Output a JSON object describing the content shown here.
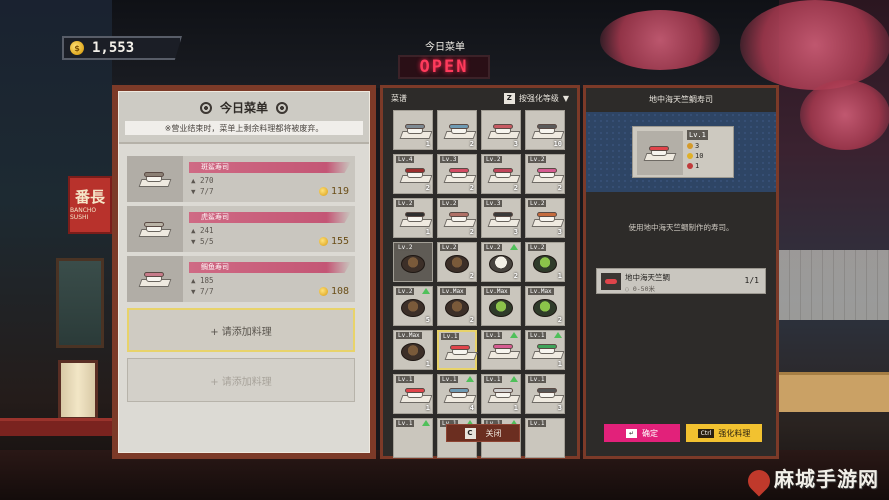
{
  "colors": {
    "accent_pink": "#e2217a",
    "accent_yellow": "#f2c230",
    "panel_frame": "#7c3a28",
    "open_red": "#ff3b5c"
  },
  "hud": {
    "currency_icon": "coin-icon",
    "currency": "1,553"
  },
  "header": {
    "today_menu": "今日菜单",
    "open_sign": "OPEN"
  },
  "left": {
    "title": "今日菜单",
    "note": "※营业结束时，菜单上剩余料理都将被废弃。",
    "dishes": [
      {
        "name": "斑鲨寿司",
        "stock": "270",
        "ratio": "7/7",
        "price": "119",
        "fish": "#8b7f74"
      },
      {
        "name": "虎鲨寿司",
        "stock": "241",
        "ratio": "5/5",
        "price": "155",
        "fish": "#b9b3a6"
      },
      {
        "name": "鲷鱼寿司",
        "stock": "185",
        "ratio": "7/7",
        "price": "108",
        "fish": "#c77b8a"
      }
    ],
    "add_slot_1": "+ 请添加料理",
    "add_slot_2": "+ 请添加料理"
  },
  "middle": {
    "tab_label": "菜谱",
    "sort_key": "Z",
    "sort_label": "按强化等级",
    "cells": [
      {
        "lv": "",
        "count": "1",
        "up": false,
        "food": "sushi",
        "color": "#7e8a93"
      },
      {
        "lv": "",
        "count": "2",
        "up": false,
        "food": "sushi",
        "color": "#6e9ab3"
      },
      {
        "lv": "",
        "count": "3",
        "up": false,
        "food": "sushi",
        "color": "#c75a62"
      },
      {
        "lv": "",
        "count": "10",
        "up": false,
        "food": "sushi",
        "color": "#5a5a5a"
      },
      {
        "lv": "Lv.4",
        "count": "2",
        "up": false,
        "food": "sushi",
        "color": "#9b2d2d"
      },
      {
        "lv": "Lv.3",
        "count": "2",
        "up": false,
        "food": "sushi",
        "color": "#d34c64"
      },
      {
        "lv": "Lv.2",
        "count": "2",
        "up": false,
        "food": "sushi",
        "color": "#c0455b"
      },
      {
        "lv": "Lv.2",
        "count": "2",
        "up": false,
        "food": "sushi",
        "color": "#d65c92"
      },
      {
        "lv": "Lv.2",
        "count": "1",
        "up": false,
        "food": "sushi",
        "color": "#2f2f2f"
      },
      {
        "lv": "Lv.2",
        "count": "2",
        "up": false,
        "food": "sushi",
        "color": "#b07066"
      },
      {
        "lv": "Lv.3",
        "count": "3",
        "up": false,
        "food": "sushi",
        "color": "#3a3a3a"
      },
      {
        "lv": "Lv.2",
        "count": "3",
        "up": false,
        "food": "sushi",
        "color": "#c56b3d"
      },
      {
        "lv": "Lv.2",
        "count": "",
        "up": false,
        "food": "bowl",
        "color": "",
        "dark": true
      },
      {
        "lv": "Lv.2",
        "count": "2",
        "up": false,
        "food": "bowl",
        "color": ""
      },
      {
        "lv": "Lv.2",
        "count": "2",
        "up": true,
        "food": "bowl-white",
        "color": ""
      },
      {
        "lv": "Lv.2",
        "count": "1",
        "up": false,
        "food": "bowl-green",
        "color": ""
      },
      {
        "lv": "Lv.2",
        "count": "5",
        "up": true,
        "food": "bowl",
        "color": ""
      },
      {
        "lv": "Lv.Max",
        "count": "2",
        "up": false,
        "food": "bowl",
        "color": ""
      },
      {
        "lv": "Lv.Max",
        "count": "",
        "up": false,
        "food": "bowl-green",
        "color": ""
      },
      {
        "lv": "Lv.Max",
        "count": "2",
        "up": false,
        "food": "bowl-green",
        "color": ""
      },
      {
        "lv": "Lv.Max",
        "count": "1",
        "up": false,
        "food": "bowl",
        "color": ""
      },
      {
        "lv": "Lv.1",
        "count": "",
        "up": false,
        "food": "sushi",
        "color": "#e0444a",
        "hl": true
      },
      {
        "lv": "Lv.1",
        "count": "",
        "up": true,
        "food": "sushi",
        "color": "#d65c92"
      },
      {
        "lv": "Lv.1",
        "count": "1",
        "up": true,
        "food": "sushi",
        "color": "#3fa35a"
      },
      {
        "lv": "Lv.1",
        "count": "1",
        "up": false,
        "food": "sushi",
        "color": "#e0444a"
      },
      {
        "lv": "Lv.1",
        "count": "4",
        "up": true,
        "food": "sushi",
        "color": "#6e9ab3"
      },
      {
        "lv": "Lv.1",
        "count": "1",
        "up": true,
        "food": "sushi",
        "color": "#cfcfcf"
      },
      {
        "lv": "Lv.1",
        "count": "3",
        "up": false,
        "food": "sushi",
        "color": "#555555"
      },
      {
        "lv": "Lv.1",
        "count": "",
        "up": true,
        "food": "",
        "color": ""
      },
      {
        "lv": "Lv.1",
        "count": "",
        "up": true,
        "food": "",
        "color": ""
      },
      {
        "lv": "Lv.1",
        "count": "",
        "up": true,
        "food": "",
        "color": ""
      },
      {
        "lv": "Lv.1",
        "count": "",
        "up": false,
        "food": "",
        "color": ""
      }
    ],
    "close_key": "C",
    "close_label": "关闭"
  },
  "right": {
    "title": "地中海天竺鲷寿司",
    "level": "Lv.1",
    "stat_a": "3",
    "stat_b": "10",
    "stat_c": "1",
    "description": "使用地中海天竺鲷制作的寿司。",
    "ingredient_name": "地中海天竺鲷",
    "ingredient_range": "0-50米",
    "ingredient_count": "1/1",
    "confirm_key": "↵",
    "confirm_label": "确定",
    "upgrade_key": "Ctrl",
    "upgrade_label": "强化料理"
  },
  "scene": {
    "sign_big": "番長",
    "sign_small": "BANCHO SUSHI",
    "watermark": "麻城手游网"
  }
}
